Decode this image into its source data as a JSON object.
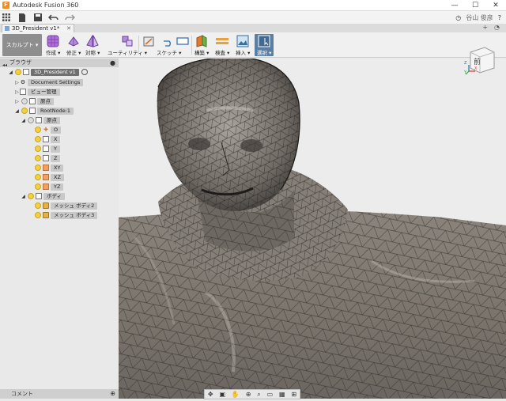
{
  "window": {
    "app_title": "Autodesk Fusion 360",
    "controls": {
      "minimize": "—",
      "maximize": "☐",
      "close": "✕"
    }
  },
  "quick_access": {
    "icons": [
      "grid-icon",
      "file-icon",
      "save-icon",
      "undo-icon",
      "redo-icon"
    ],
    "user_name": "谷山 俊彦",
    "help_label": "?"
  },
  "document": {
    "tab_title": "3D_President v1*"
  },
  "ribbon": {
    "workspace": "スカルプト ▾",
    "tools": [
      {
        "label": "作成 ▾"
      },
      {
        "label": "修正 ▾"
      },
      {
        "label": "対称 ▾"
      },
      {
        "label": "ユーティリティ ▾"
      },
      {
        "label": ""
      },
      {
        "label": "スケッチ ▾"
      },
      {
        "label": ""
      },
      {
        "label": "構築 ▾"
      },
      {
        "label": "検査 ▾"
      },
      {
        "label": "挿入 ▾"
      },
      {
        "label": "選択 ▾"
      }
    ]
  },
  "browser": {
    "title": "ブラウザ",
    "root": "3D_President v1",
    "items": {
      "document_settings": "Document Settings",
      "named_views": "ビュー管理",
      "origin_top": "原点",
      "root_node": "RootNode:1",
      "origin": "原点",
      "o": "O",
      "x": "X",
      "y": "Y",
      "z": "Z",
      "xy": "XY",
      "xz": "XZ",
      "yz": "YZ",
      "bodies": "ボディ",
      "mesh1": "メッシュ ボディ2",
      "mesh2": "メッシュ ボディ3"
    }
  },
  "comments": {
    "title": "コメント"
  },
  "viewcube": {
    "face": "前",
    "x": "X",
    "y": "Y",
    "z": "Z"
  },
  "navbar": {
    "icons": [
      "orbit-icon",
      "pan-icon",
      "zoom-icon",
      "fit-icon",
      "display-icon",
      "grid-icon",
      "view-icon"
    ]
  }
}
